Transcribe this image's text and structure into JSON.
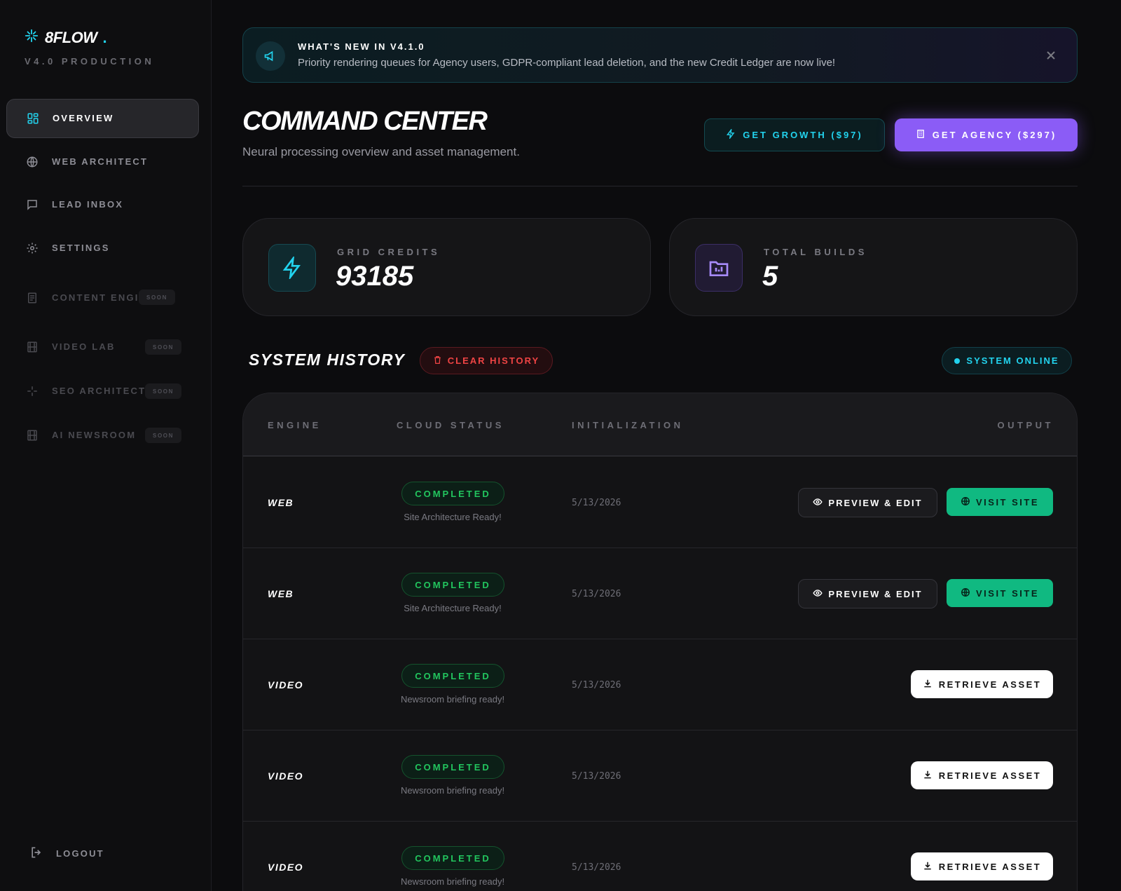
{
  "brand": {
    "name": "8FLOW",
    "dot": ".",
    "subtitle": "V4.0 PRODUCTION"
  },
  "sidebar": {
    "items": [
      {
        "label": "OVERVIEW",
        "icon": "grid-icon",
        "active": true
      },
      {
        "label": "WEB ARCHITECT",
        "icon": "globe-icon"
      },
      {
        "label": "LEAD INBOX",
        "icon": "chat-icon"
      },
      {
        "label": "SETTINGS",
        "icon": "gear-icon"
      },
      {
        "label": "CONTENT ENGINE",
        "icon": "document-icon",
        "badge": "SOON"
      },
      {
        "label": "VIDEO LAB",
        "icon": "film-icon",
        "badge": "SOON"
      },
      {
        "label": "SEO ARCHITECT",
        "icon": "sparkle-icon",
        "badge": "SOON"
      },
      {
        "label": "AI NEWSROOM",
        "icon": "newspaper-icon",
        "badge": "SOON"
      }
    ],
    "logout": "LOGOUT"
  },
  "banner": {
    "title": "WHAT'S NEW IN V4.1.0",
    "text": "Priority rendering queues for Agency users, GDPR-compliant lead deletion, and the new Credit Ledger are now live!"
  },
  "header": {
    "title": "COMMAND CENTER",
    "subtitle": "Neural processing overview and asset management.",
    "growth_button": "GET GROWTH ($97)",
    "agency_button": "GET AGENCY ($297)"
  },
  "stats": [
    {
      "label": "GRID CREDITS",
      "value": "93185",
      "icon": "lightning-icon"
    },
    {
      "label": "TOTAL BUILDS",
      "value": "5",
      "icon": "folder-chart-icon"
    }
  ],
  "history": {
    "title": "SYSTEM HISTORY",
    "clear_button": "CLEAR HISTORY",
    "status": "SYSTEM ONLINE",
    "columns": [
      "ENGINE",
      "CLOUD STATUS",
      "INITIALIZATION",
      "OUTPUT"
    ],
    "rows": [
      {
        "engine": "WEB",
        "status": "COMPLETED",
        "detail": "Site Architecture Ready!",
        "date": "5/13/2026",
        "actions": [
          "PREVIEW & EDIT",
          "VISIT SITE"
        ]
      },
      {
        "engine": "WEB",
        "status": "COMPLETED",
        "detail": "Site Architecture Ready!",
        "date": "5/13/2026",
        "actions": [
          "PREVIEW & EDIT",
          "VISIT SITE"
        ]
      },
      {
        "engine": "VIDEO",
        "status": "COMPLETED",
        "detail": "Newsroom briefing ready!",
        "date": "5/13/2026",
        "actions": [
          "RETRIEVE ASSET"
        ]
      },
      {
        "engine": "VIDEO",
        "status": "COMPLETED",
        "detail": "Newsroom briefing ready!",
        "date": "5/13/2026",
        "actions": [
          "RETRIEVE ASSET"
        ]
      },
      {
        "engine": "VIDEO",
        "status": "COMPLETED",
        "detail": "Newsroom briefing ready!",
        "date": "5/13/2026",
        "actions": [
          "RETRIEVE ASSET"
        ]
      }
    ]
  },
  "colors": {
    "accent_cyan": "#22d3ee",
    "accent_purple": "#8b5cf6",
    "success_green": "#10b981",
    "danger_red": "#ef4444",
    "background": "#0c0c0e"
  }
}
